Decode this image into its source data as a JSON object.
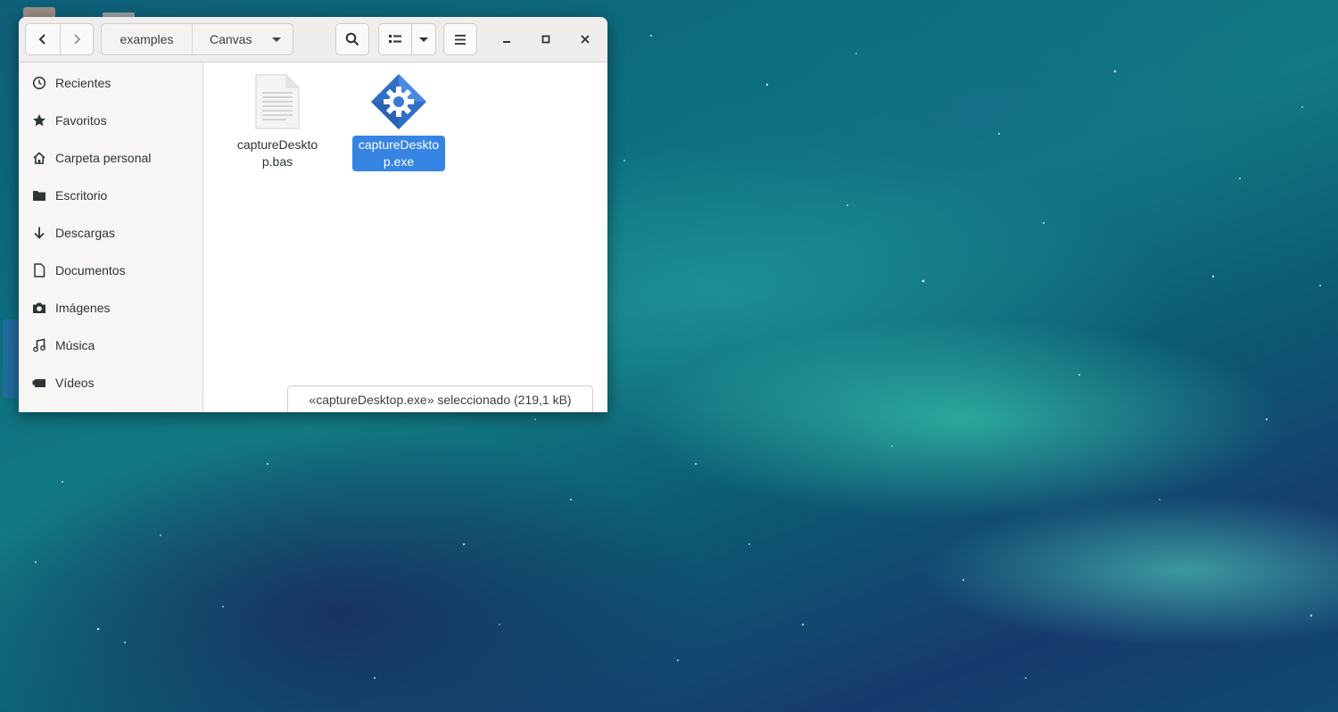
{
  "window": {
    "path": [
      "examples",
      "Canvas"
    ]
  },
  "sidebar": {
    "items": [
      {
        "label": "Recientes",
        "icon": "clock-icon"
      },
      {
        "label": "Favoritos",
        "icon": "star-icon"
      },
      {
        "label": "Carpeta personal",
        "icon": "home-icon"
      },
      {
        "label": "Escritorio",
        "icon": "folder-icon"
      },
      {
        "label": "Descargas",
        "icon": "download-icon"
      },
      {
        "label": "Documentos",
        "icon": "document-icon"
      },
      {
        "label": "Imágenes",
        "icon": "camera-icon"
      },
      {
        "label": "Música",
        "icon": "music-note-icon"
      },
      {
        "label": "Vídeos",
        "icon": "video-icon"
      }
    ]
  },
  "files": [
    {
      "name": "captureDesktop.bas",
      "icon": "text-file-icon",
      "selected": false
    },
    {
      "name": "captureDesktop.exe",
      "icon": "executable-gear-icon",
      "selected": true
    }
  ],
  "status": {
    "text": "«captureDesktop.exe» seleccionado  (219,1 kB)"
  },
  "colors": {
    "selection": "#3584e4",
    "headerbar": "#f0eeec",
    "sidebar": "#f7f6f5"
  }
}
